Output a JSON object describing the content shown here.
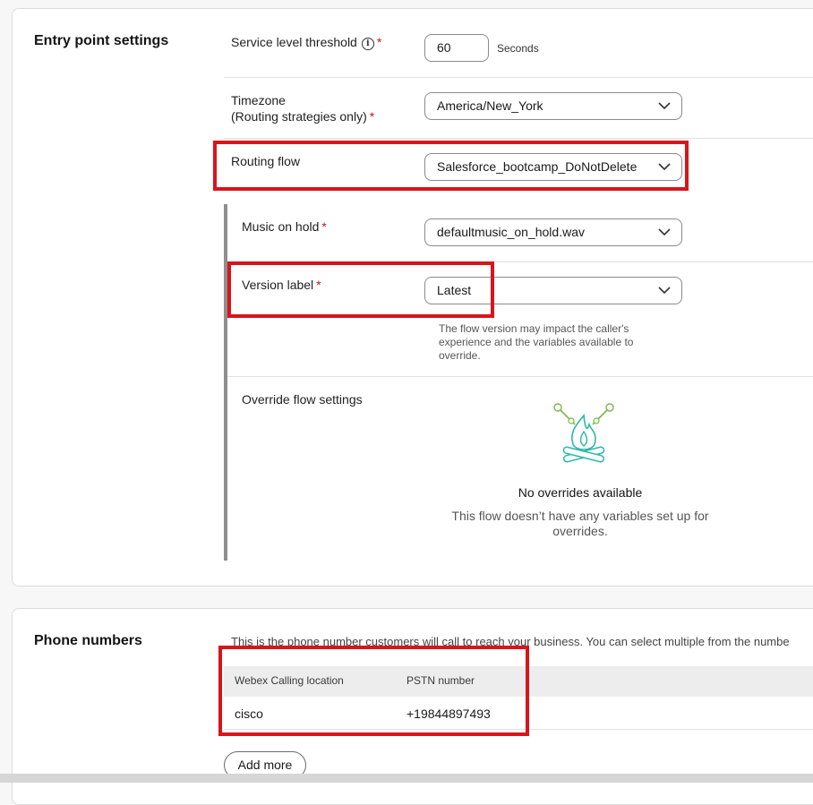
{
  "entry_point": {
    "section_title": "Entry point settings",
    "service_level": {
      "label": "Service level threshold",
      "value": "60",
      "unit": "Seconds"
    },
    "timezone": {
      "label_line1": "Timezone",
      "label_line2": "(Routing strategies only)",
      "value": "America/New_York"
    },
    "routing_flow": {
      "label": "Routing flow",
      "value": "Salesforce_bootcamp_DoNotDelete"
    },
    "music_on_hold": {
      "label": "Music on hold",
      "value": "defaultmusic_on_hold.wav"
    },
    "version_label": {
      "label": "Version label",
      "value": "Latest",
      "helper_line1": "The flow version may impact the caller's",
      "helper_line2": "experience and the variables available to",
      "helper_line3": "override."
    },
    "override": {
      "label": "Override flow settings",
      "empty_title": "No overrides available",
      "empty_desc_line1": "This flow doesn’t have any variables set up for",
      "empty_desc_line2": "overrides."
    }
  },
  "phone_numbers": {
    "section_title": "Phone numbers",
    "description": "This is the phone number customers will call to reach your business. You can select multiple from the numbe",
    "columns": [
      "Webex Calling location",
      "PSTN number"
    ],
    "rows": [
      {
        "location": "cisco",
        "pstn": "+19844897493"
      }
    ],
    "add_more_label": "Add more"
  },
  "colors": {
    "highlight": "#d9141b",
    "required": "#c4161c",
    "icon_accent": "#2bb8a8",
    "icon_green": "#7ab648"
  }
}
